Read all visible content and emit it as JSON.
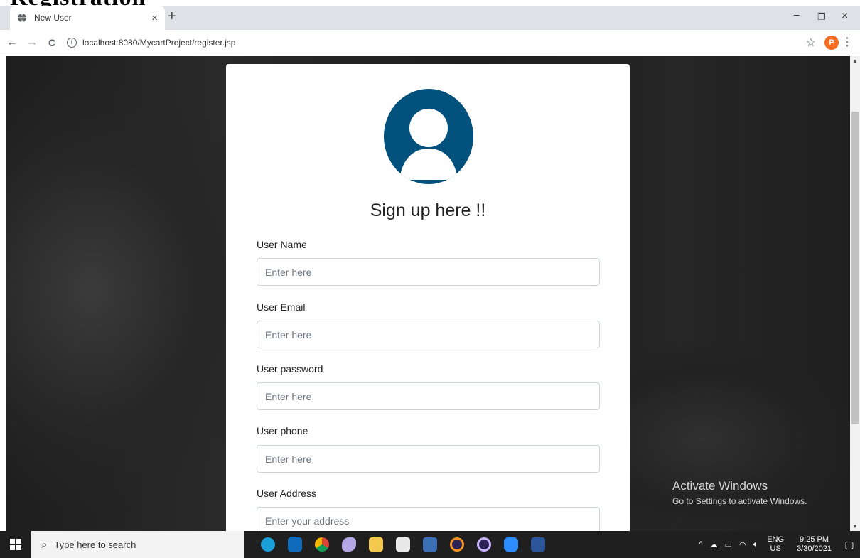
{
  "page_heading_partial": "Registration",
  "browser": {
    "tab_title": "New User",
    "tab_close": "×",
    "new_tab": "+",
    "url": "localhost:8080/MycartProject/register.jsp",
    "back": "←",
    "forward": "→",
    "reload": "C",
    "info": "i",
    "star": "☆",
    "profile_initial": "P",
    "menu": "⋮",
    "minimize": "−",
    "restore": "❐",
    "close": "×"
  },
  "form": {
    "title": "Sign up here !!",
    "fields": [
      {
        "label": "User Name",
        "placeholder": "Enter here"
      },
      {
        "label": "User Email",
        "placeholder": "Enter here"
      },
      {
        "label": "User password",
        "placeholder": "Enter here"
      },
      {
        "label": "User phone",
        "placeholder": "Enter here"
      },
      {
        "label": "User Address",
        "placeholder": "Enter your address"
      }
    ],
    "avatar_color": "#03527e"
  },
  "watermark": {
    "title": "Activate Windows",
    "subtitle": "Go to Settings to activate Windows."
  },
  "taskbar": {
    "search_placeholder": "Type here to search",
    "icons": [
      "edge-icon",
      "mail-icon",
      "chrome-icon",
      "paint-icon",
      "file-explorer-icon",
      "store-icon",
      "vscode-icon",
      "eclipse-icon",
      "eclipse-icon-2",
      "zoom-icon",
      "word-icon"
    ],
    "lang_top": "ENG",
    "lang_bottom": "US",
    "time": "9:25 PM",
    "date": "3/30/2021",
    "tray_chevron": "^"
  }
}
